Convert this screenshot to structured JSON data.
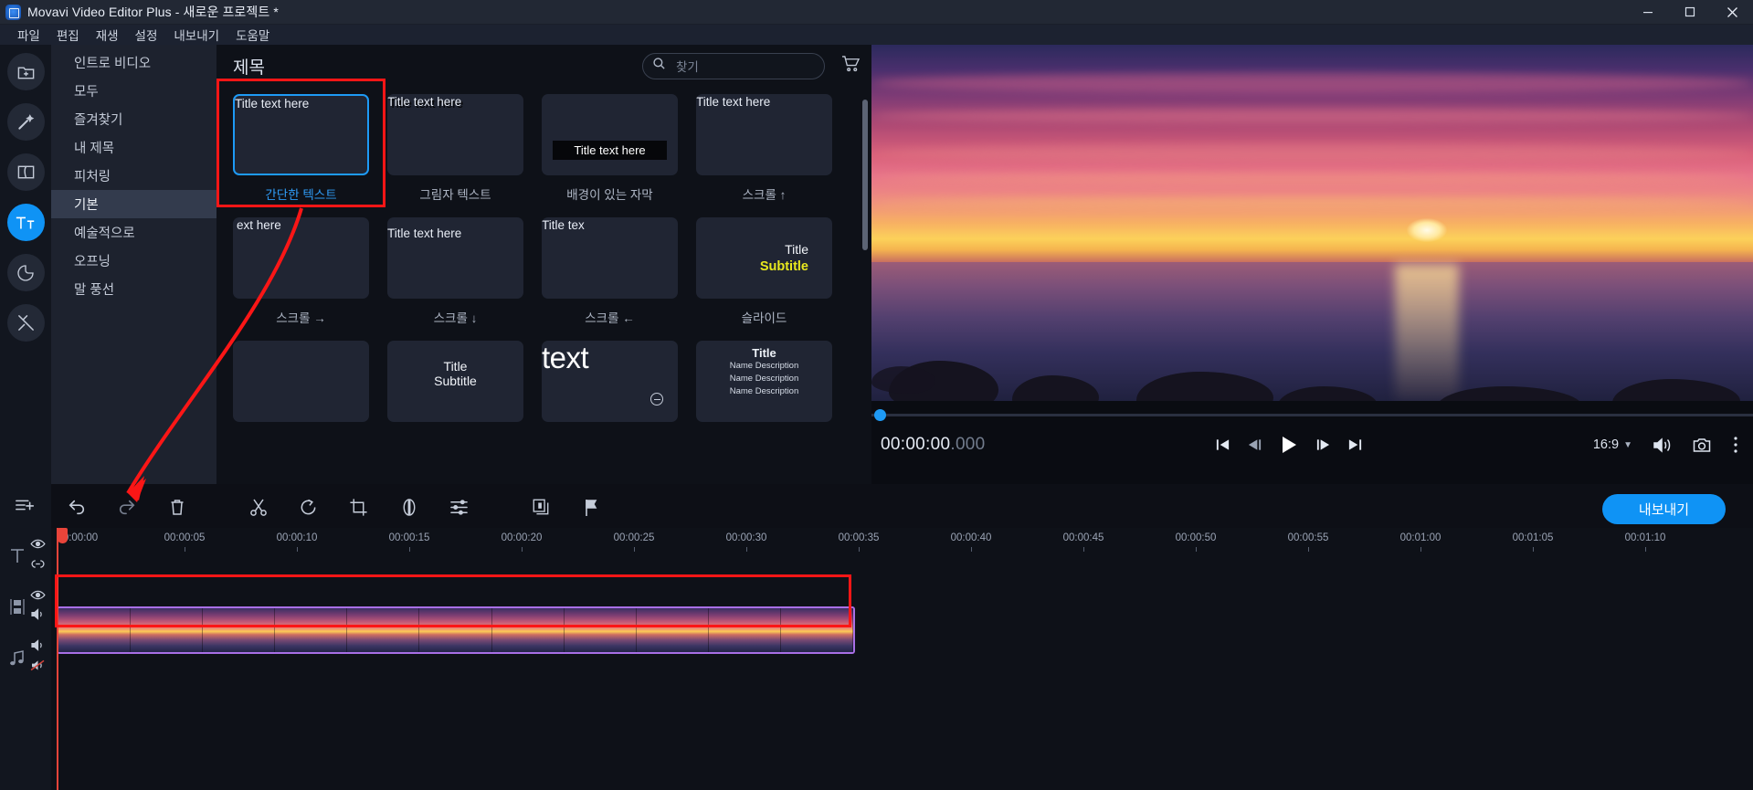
{
  "window": {
    "title": "Movavi Video Editor Plus - 새로운 프로젝트 *",
    "logo_icon": "movavi-logo-icon",
    "minimize_icon": "minimize-icon",
    "maximize_icon": "maximize-icon",
    "close_icon": "close-icon"
  },
  "menu": {
    "items": [
      {
        "label": "파일"
      },
      {
        "label": "편집"
      },
      {
        "label": "재생"
      },
      {
        "label": "설정"
      },
      {
        "label": "내보내기"
      },
      {
        "label": "도움말"
      }
    ]
  },
  "rail": {
    "items": [
      {
        "name": "import-media",
        "icon": "folder-plus-icon",
        "active": false
      },
      {
        "name": "filters",
        "icon": "magic-wand-icon",
        "active": false
      },
      {
        "name": "transitions",
        "icon": "transition-icon",
        "active": false
      },
      {
        "name": "titles",
        "icon": "titles-Tt-icon",
        "active": true
      },
      {
        "name": "stickers",
        "icon": "sticker-icon",
        "active": false
      },
      {
        "name": "more-tools",
        "icon": "tools-icon",
        "active": false
      }
    ]
  },
  "categories": {
    "items": [
      {
        "label": "인트로 비디오",
        "selected": false
      },
      {
        "label": "모두",
        "selected": false
      },
      {
        "label": "즐겨찾기",
        "selected": false
      },
      {
        "label": "내 제목",
        "selected": false
      },
      {
        "label": "피처링",
        "selected": false
      },
      {
        "label": "기본",
        "selected": true
      },
      {
        "label": "예술적으로",
        "selected": false
      },
      {
        "label": "오프닝",
        "selected": false
      },
      {
        "label": "말 풍선",
        "selected": false
      }
    ]
  },
  "browser": {
    "title": "제목",
    "search": {
      "placeholder": "찾기",
      "value": "",
      "icon": "search-icon"
    },
    "cart_icon": "cart-icon",
    "cards": [
      {
        "label": "간단한 텍스트",
        "preview": "Title text here",
        "style": "plain",
        "selected": true
      },
      {
        "label": "그림자 텍스트",
        "preview": "Title text here",
        "style": "shadow",
        "selected": false
      },
      {
        "label": "배경이 있는 자막",
        "preview": "Title text here",
        "style": "bgbar",
        "selected": false
      },
      {
        "label": "스크롤 ↑",
        "preview": "Title text here",
        "style": "bottom",
        "selected": false
      },
      {
        "label": "스크롤 →",
        "preview": "ext here",
        "style": "left",
        "selected": false
      },
      {
        "label": "스크롤 ↓",
        "preview": "Title text here",
        "style": "top",
        "selected": false
      },
      {
        "label": "스크롤 ←",
        "preview": "Title tex",
        "style": "right",
        "selected": false
      },
      {
        "label": "슬라이드",
        "preview_title": "Title",
        "preview_subtitle": "Subtitle",
        "style": "slide",
        "selected": false
      },
      {
        "label": "",
        "preview": "",
        "style": "empty",
        "selected": false
      },
      {
        "label": "",
        "preview_title": "Title",
        "preview_subtitle": "Subtitle",
        "style": "titlesub",
        "selected": false
      },
      {
        "label": "",
        "preview": "text",
        "style": "bigtext",
        "selected": false
      },
      {
        "label": "",
        "preview_title": "Title",
        "preview_lines": [
          "Name Description",
          "Name Description",
          "Name Description"
        ],
        "style": "namelist",
        "selected": false
      }
    ]
  },
  "preview": {
    "timecode_main": "00:00:00",
    "timecode_ms": ".000",
    "aspect_ratio": "16:9",
    "buttons": {
      "prev_clip_icon": "skip-to-start-icon",
      "prev_frame_icon": "previous-frame-icon",
      "play_icon": "play-icon",
      "next_frame_icon": "next-frame-icon",
      "next_clip_icon": "skip-to-end-icon",
      "volume_icon": "volume-icon",
      "snapshot_icon": "camera-icon",
      "more_icon": "more-vertical-icon"
    }
  },
  "toolbar": {
    "buttons": [
      {
        "name": "undo",
        "icon": "undo-arrow-icon"
      },
      {
        "name": "redo",
        "icon": "redo-arrow-icon"
      },
      {
        "name": "delete",
        "icon": "trash-icon"
      },
      {
        "name": "split",
        "icon": "scissors-icon"
      },
      {
        "name": "rotate",
        "icon": "rotate-icon"
      },
      {
        "name": "crop",
        "icon": "crop-icon"
      },
      {
        "name": "color-adjust",
        "icon": "contrast-circle-icon"
      },
      {
        "name": "properties",
        "icon": "sliders-icon"
      },
      {
        "name": "chroma-key",
        "icon": "layers-icon"
      },
      {
        "name": "marker",
        "icon": "flag-icon"
      }
    ],
    "export_label": "내보내기"
  },
  "track_rail": {
    "add_track_icon": "add-track-icon",
    "tracks": [
      {
        "name": "title-track",
        "icon": "title-T-icon",
        "toggles": [
          "eye-icon",
          "link-icon"
        ]
      },
      {
        "name": "video-track",
        "icon": "film-strip-icon",
        "toggles": [
          "eye-icon",
          "speaker-icon"
        ]
      },
      {
        "name": "audio-track",
        "icon": "music-note-icon",
        "toggles": [
          "speaker-icon",
          "speaker-muted-icon"
        ]
      }
    ]
  },
  "timeline": {
    "ticks": [
      "0:00:00",
      "00:00:05",
      "00:00:10",
      "00:00:15",
      "00:00:20",
      "00:00:25",
      "00:00:30",
      "00:00:35",
      "00:00:40",
      "00:00:45",
      "00:00:50",
      "00:00:55",
      "00:01:00",
      "00:01:05",
      "00:01:10"
    ],
    "playhead_position": "00:00:00",
    "video_clip_frames": 11
  },
  "annotations": {
    "highlight_color": "#fb1616",
    "box_1_target": "간단한 텍스트 card",
    "box_2_target": "title track drop area",
    "arrow": "drag from title card to title track"
  }
}
